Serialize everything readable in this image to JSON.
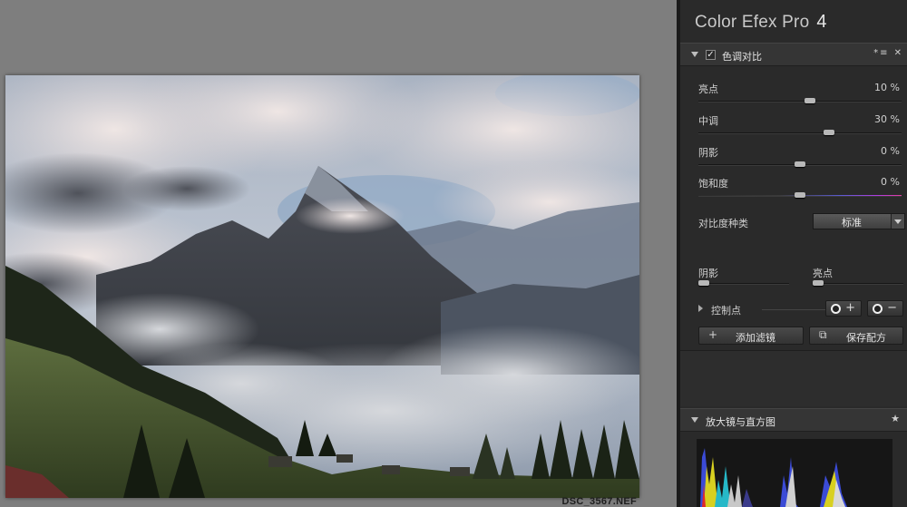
{
  "file": {
    "name": "DSC_3567.NEF"
  },
  "app": {
    "title": "Color Efex Pro",
    "version": "4"
  },
  "filter": {
    "name": "色调对比",
    "checked": "✓",
    "header_icons": "*≡ ✕",
    "sliders": [
      {
        "label": "亮点",
        "value": "10 %",
        "fraction": 0.55
      },
      {
        "label": "中调",
        "value": "30 %",
        "fraction": 0.65
      },
      {
        "label": "阴影",
        "value": "0 %",
        "fraction": 0.5
      },
      {
        "label": "饱和度",
        "value": "0 %",
        "fraction": 0.5
      }
    ],
    "contrast_type": {
      "label": "对比度种类",
      "value": "标准"
    },
    "mini_sliders": [
      {
        "label": "阴影",
        "fraction": 0.0
      },
      {
        "label": "亮点",
        "fraction": 0.0
      }
    ]
  },
  "control_points": {
    "label": "控制点",
    "add_symbol": "+",
    "remove_symbol": "−"
  },
  "actions": {
    "add_filter": "添加滤镜",
    "add_icon": "+",
    "save_recipe": "保存配方",
    "save_icon": "⧉"
  },
  "loupe": {
    "title": "放大镜与直方图",
    "pin_icon": "pin-icon"
  },
  "colors": {
    "panel_bg": "#2a2a2a",
    "canvas_bg": "#7e7e7e",
    "header_bg": "#353535"
  }
}
